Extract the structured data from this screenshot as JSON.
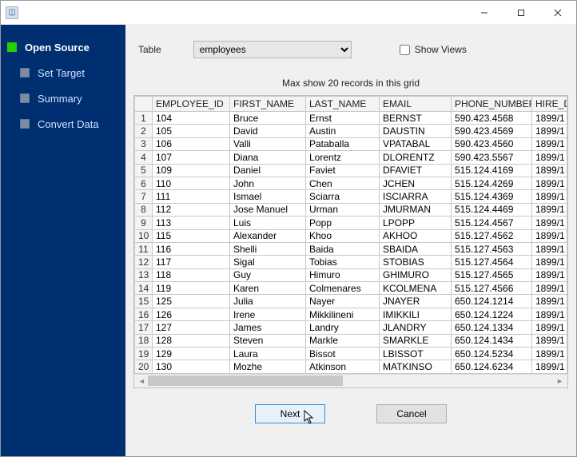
{
  "window": {
    "title": ""
  },
  "sidebar": {
    "steps": [
      {
        "label": "Open Source",
        "active": true
      },
      {
        "label": "Set Target",
        "active": false
      },
      {
        "label": "Summary",
        "active": false
      },
      {
        "label": "Convert Data",
        "active": false
      }
    ]
  },
  "form": {
    "table_label": "Table",
    "table_selected": "employees",
    "show_views_label": "Show Views",
    "show_views_checked": false
  },
  "hint": "Max show 20 records in this grid",
  "grid": {
    "columns": [
      "EMPLOYEE_ID",
      "FIRST_NAME",
      "LAST_NAME",
      "EMAIL",
      "PHONE_NUMBER",
      "HIRE_D"
    ],
    "rows": [
      {
        "n": 1,
        "c": [
          "104",
          "Bruce",
          "Ernst",
          "BERNST",
          "590.423.4568",
          "1899/1"
        ]
      },
      {
        "n": 2,
        "c": [
          "105",
          "David",
          "Austin",
          "DAUSTIN",
          "590.423.4569",
          "1899/1"
        ]
      },
      {
        "n": 3,
        "c": [
          "106",
          "Valli",
          "Pataballa",
          "VPATABAL",
          "590.423.4560",
          "1899/1"
        ]
      },
      {
        "n": 4,
        "c": [
          "107",
          "Diana",
          "Lorentz",
          "DLORENTZ",
          "590.423.5567",
          "1899/1"
        ]
      },
      {
        "n": 5,
        "c": [
          "109",
          "Daniel",
          "Faviet",
          "DFAVIET",
          "515.124.4169",
          "1899/1"
        ]
      },
      {
        "n": 6,
        "c": [
          "110",
          "John",
          "Chen",
          "JCHEN",
          "515.124.4269",
          "1899/1"
        ]
      },
      {
        "n": 7,
        "c": [
          "111",
          "Ismael",
          "Sciarra",
          "ISCIARRA",
          "515.124.4369",
          "1899/1"
        ]
      },
      {
        "n": 8,
        "c": [
          "112",
          "Jose Manuel",
          "Urman",
          "JMURMAN",
          "515.124.4469",
          "1899/1"
        ]
      },
      {
        "n": 9,
        "c": [
          "113",
          "Luis",
          "Popp",
          "LPOPP",
          "515.124.4567",
          "1899/1"
        ]
      },
      {
        "n": 10,
        "c": [
          "115",
          "Alexander",
          "Khoo",
          "AKHOO",
          "515.127.4562",
          "1899/1"
        ]
      },
      {
        "n": 11,
        "c": [
          "116",
          "Shelli",
          "Baida",
          "SBAIDA",
          "515.127.4563",
          "1899/1"
        ]
      },
      {
        "n": 12,
        "c": [
          "117",
          "Sigal",
          "Tobias",
          "STOBIAS",
          "515.127.4564",
          "1899/1"
        ]
      },
      {
        "n": 13,
        "c": [
          "118",
          "Guy",
          "Himuro",
          "GHIMURO",
          "515.127.4565",
          "1899/1"
        ]
      },
      {
        "n": 14,
        "c": [
          "119",
          "Karen",
          "Colmenares",
          "KCOLMENA",
          "515.127.4566",
          "1899/1"
        ]
      },
      {
        "n": 15,
        "c": [
          "125",
          "Julia",
          "Nayer",
          "JNAYER",
          "650.124.1214",
          "1899/1"
        ]
      },
      {
        "n": 16,
        "c": [
          "126",
          "Irene",
          "Mikkilineni",
          "IMIKKILI",
          "650.124.1224",
          "1899/1"
        ]
      },
      {
        "n": 17,
        "c": [
          "127",
          "James",
          "Landry",
          "JLANDRY",
          "650.124.1334",
          "1899/1"
        ]
      },
      {
        "n": 18,
        "c": [
          "128",
          "Steven",
          "Markle",
          "SMARKLE",
          "650.124.1434",
          "1899/1"
        ]
      },
      {
        "n": 19,
        "c": [
          "129",
          "Laura",
          "Bissot",
          "LBISSOT",
          "650.124.5234",
          "1899/1"
        ]
      },
      {
        "n": 20,
        "c": [
          "130",
          "Mozhe",
          "Atkinson",
          "MATKINSO",
          "650.124.6234",
          "1899/1"
        ]
      }
    ]
  },
  "buttons": {
    "next": "Next",
    "cancel": "Cancel"
  }
}
